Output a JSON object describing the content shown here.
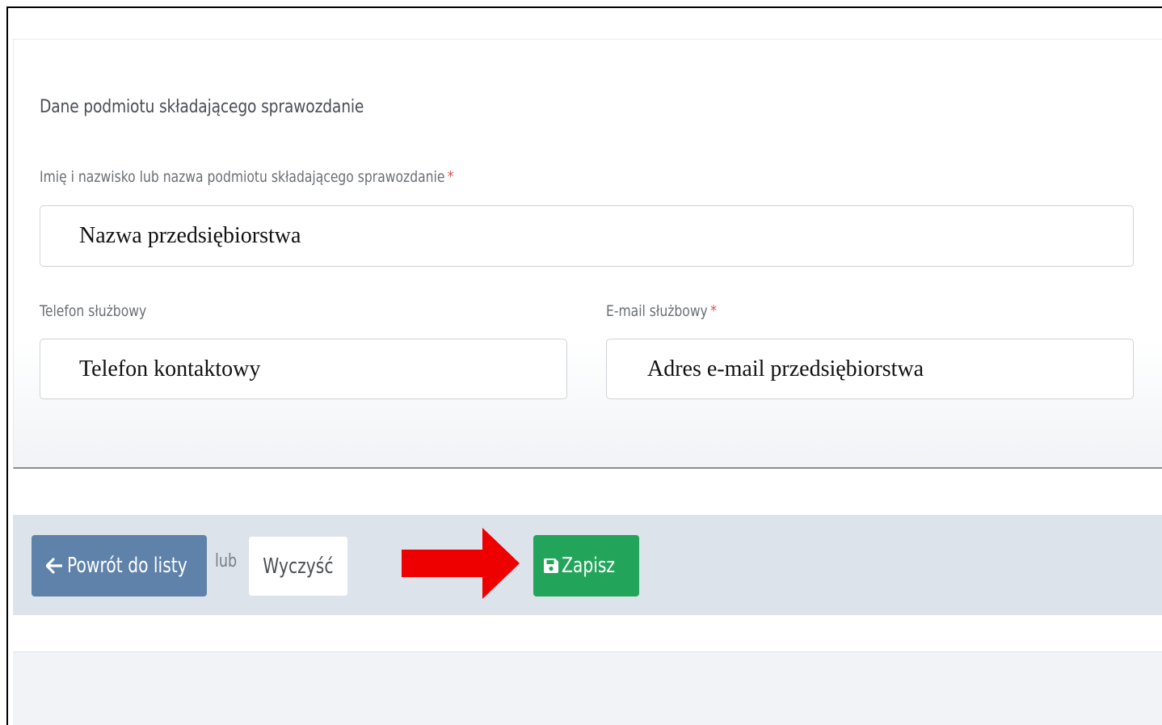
{
  "section": {
    "title": "Dane podmiotu składającego sprawozdanie"
  },
  "fields": {
    "name": {
      "label": "Imię i nazwisko lub nazwa podmiotu składającego sprawozdanie",
      "required_mark": "*",
      "value": "Nazwa przedsiębiorstwa"
    },
    "phone": {
      "label": "Telefon służbowy",
      "value": "Telefon kontaktowy"
    },
    "email": {
      "label": "E-mail służbowy",
      "required_mark": "*",
      "value": "Adres e-mail przedsiębiorstwa"
    }
  },
  "actions": {
    "back_label": "Powrót do listy",
    "separator": "lub",
    "clear_label": "Wyczyść",
    "save_label": "Zapisz"
  },
  "icons": {
    "back": "arrow-left-icon",
    "save": "floppy-disk-icon",
    "annotation": "red-arrow-icon"
  },
  "colors": {
    "back_button": "#5f82ab",
    "save_button": "#22a55a",
    "required": "#d9534f",
    "annotation_arrow": "#ee0000",
    "footer_bar": "#dde3ea"
  }
}
